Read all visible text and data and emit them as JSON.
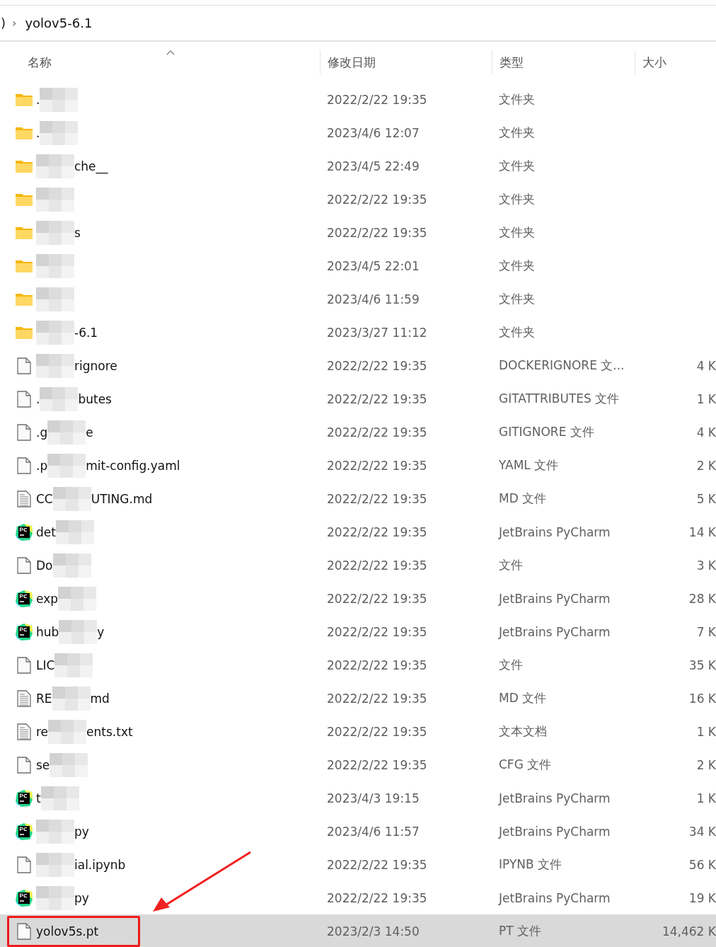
{
  "breadcrumb": {
    "parent_fragment": ")",
    "separator": "›",
    "current": "yolov5-6.1"
  },
  "columns": [
    {
      "label": "名称",
      "sorted": true
    },
    {
      "label": "修改日期",
      "sorted": false
    },
    {
      "label": "类型",
      "sorted": false
    },
    {
      "label": "大小",
      "sorted": false
    }
  ],
  "rows": [
    {
      "kind": "folder",
      "lead": ".",
      "redacted": true,
      "date": "2022/2/22 19:35",
      "type": "文件夹",
      "selected": false
    },
    {
      "kind": "folder",
      "lead": ".",
      "redacted": true,
      "date": "2023/4/6 12:07",
      "type": "文件夹",
      "selected": false
    },
    {
      "kind": "folder",
      "redacted": true,
      "tail": "che__",
      "date": "2023/4/5 22:49",
      "type": "文件夹",
      "selected": false
    },
    {
      "kind": "folder",
      "redacted": true,
      "date": "2022/2/22 19:35",
      "type": "文件夹",
      "selected": false
    },
    {
      "kind": "folder",
      "redacted": true,
      "tail": "s",
      "date": "2022/2/22 19:35",
      "type": "文件夹",
      "selected": false
    },
    {
      "kind": "folder",
      "redacted": true,
      "date": "2023/4/5 22:01",
      "type": "文件夹",
      "selected": false
    },
    {
      "kind": "folder",
      "redacted": true,
      "date": "2023/4/6 11:59",
      "type": "文件夹",
      "selected": false
    },
    {
      "kind": "folder",
      "redacted": true,
      "tail": "-6.1",
      "date": "2023/3/27 11:12",
      "type": "文件夹",
      "selected": false
    },
    {
      "kind": "file",
      "redacted": true,
      "tail": "rignore",
      "date": "2022/2/22 19:35",
      "type": "DOCKERIGNORE 文...",
      "size": "4 K",
      "selected": false
    },
    {
      "kind": "file",
      "lead": ".",
      "redacted": true,
      "tail": "butes",
      "date": "2022/2/22 19:35",
      "type": "GITATTRIBUTES 文件",
      "size": "1 K",
      "selected": false
    },
    {
      "kind": "file",
      "lead": ".g",
      "redacted": true,
      "tail": "e",
      "date": "2022/2/22 19:35",
      "type": "GITIGNORE 文件",
      "size": "4 K",
      "selected": false
    },
    {
      "kind": "file",
      "lead": ".p",
      "redacted": true,
      "tail": "mit-config.yaml",
      "date": "2022/2/22 19:35",
      "type": "YAML 文件",
      "size": "2 K",
      "selected": false
    },
    {
      "kind": "text",
      "lead": "CC",
      "redacted": true,
      "tail": "UTING.md",
      "date": "2022/2/22 19:35",
      "type": "MD 文件",
      "size": "5 K",
      "selected": false
    },
    {
      "kind": "pycharm",
      "lead": "det",
      "redacted": true,
      "date": "2022/2/22 19:35",
      "type": "JetBrains PyCharm",
      "size": "14 K",
      "selected": false
    },
    {
      "kind": "file",
      "lead": "Do",
      "redacted": true,
      "date": "2022/2/22 19:35",
      "type": "文件",
      "size": "3 K",
      "selected": false
    },
    {
      "kind": "pycharm",
      "lead": "exp",
      "redacted": true,
      "date": "2022/2/22 19:35",
      "type": "JetBrains PyCharm",
      "size": "28 K",
      "selected": false
    },
    {
      "kind": "pycharm",
      "lead": "hub",
      "redacted": true,
      "tail": "y",
      "date": "2022/2/22 19:35",
      "type": "JetBrains PyCharm",
      "size": "7 K",
      "selected": false
    },
    {
      "kind": "file",
      "lead": "LIC",
      "redacted": true,
      "date": "2022/2/22 19:35",
      "type": "文件",
      "size": "35 K",
      "selected": false
    },
    {
      "kind": "text",
      "lead": "RE",
      "redacted": true,
      "tail": "md",
      "date": "2022/2/22 19:35",
      "type": "MD 文件",
      "size": "16 K",
      "selected": false
    },
    {
      "kind": "text",
      "lead": "re",
      "redacted": true,
      "tail": "ents.txt",
      "date": "2022/2/22 19:35",
      "type": "文本文档",
      "size": "1 K",
      "selected": false
    },
    {
      "kind": "file",
      "lead": "se",
      "redacted": true,
      "date": "2022/2/22 19:35",
      "type": "CFG 文件",
      "size": "2 K",
      "selected": false
    },
    {
      "kind": "pycharm",
      "lead": "t",
      "redacted": true,
      "date": "2023/4/3 19:15",
      "type": "JetBrains PyCharm",
      "size": "1 K",
      "selected": false
    },
    {
      "kind": "pycharm",
      "redacted": true,
      "tail": "py",
      "date": "2023/4/6 11:57",
      "type": "JetBrains PyCharm",
      "size": "34 K",
      "selected": false
    },
    {
      "kind": "file",
      "redacted": true,
      "tail": "ial.ipynb",
      "date": "2022/2/22 19:35",
      "type": "IPYNB 文件",
      "size": "56 K",
      "selected": false
    },
    {
      "kind": "pycharm",
      "redacted": true,
      "tail": "py",
      "date": "2022/2/22 19:35",
      "type": "JetBrains PyCharm",
      "size": "19 K",
      "selected": false
    },
    {
      "kind": "file",
      "lead": "yolov5s.pt",
      "redacted": false,
      "date": "2023/2/3 14:50",
      "type": "PT 文件",
      "size": "14,462 K",
      "selected": true,
      "highlighted": true
    }
  ]
}
